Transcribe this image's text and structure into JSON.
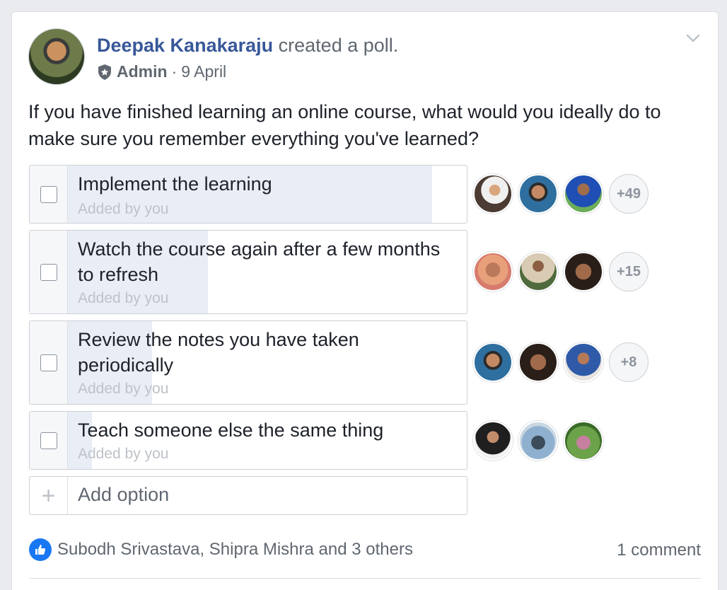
{
  "post": {
    "author": "Deepak Kanakaraju",
    "action": "created a poll.",
    "role": "Admin",
    "separator": "·",
    "date": "9 April",
    "question": "If you have finished learning an online course, what would you ideally do to make sure you remember everything you've learned?"
  },
  "poll": {
    "options": [
      {
        "text": "Implement the learning",
        "added_by": "Added by you",
        "vote_share": 0.91,
        "more_voters": "+49"
      },
      {
        "text": "Watch the course again after a few months to refresh",
        "added_by": "Added by you",
        "vote_share": 0.35,
        "more_voters": "+15"
      },
      {
        "text": "Review the notes you have taken periodically",
        "added_by": "Added by you",
        "vote_share": 0.21,
        "more_voters": "+8"
      },
      {
        "text": "Teach someone else the same thing",
        "added_by": "Added by you",
        "vote_share": 0.06,
        "more_voters": ""
      }
    ],
    "add_option_label": "Add option",
    "add_option_icon": "+"
  },
  "footer": {
    "reactions_text": "Subodh Srivastava, Shipra Mishra and 3 others",
    "comments_text": "1 comment"
  },
  "colors": {
    "link": "#385898",
    "like": "#1877f2",
    "bar_fill": "#e9edf6"
  },
  "icons": {
    "role_badge": "shield-icon",
    "menu": "chevron-down-icon",
    "like": "thumbs-up-icon"
  }
}
